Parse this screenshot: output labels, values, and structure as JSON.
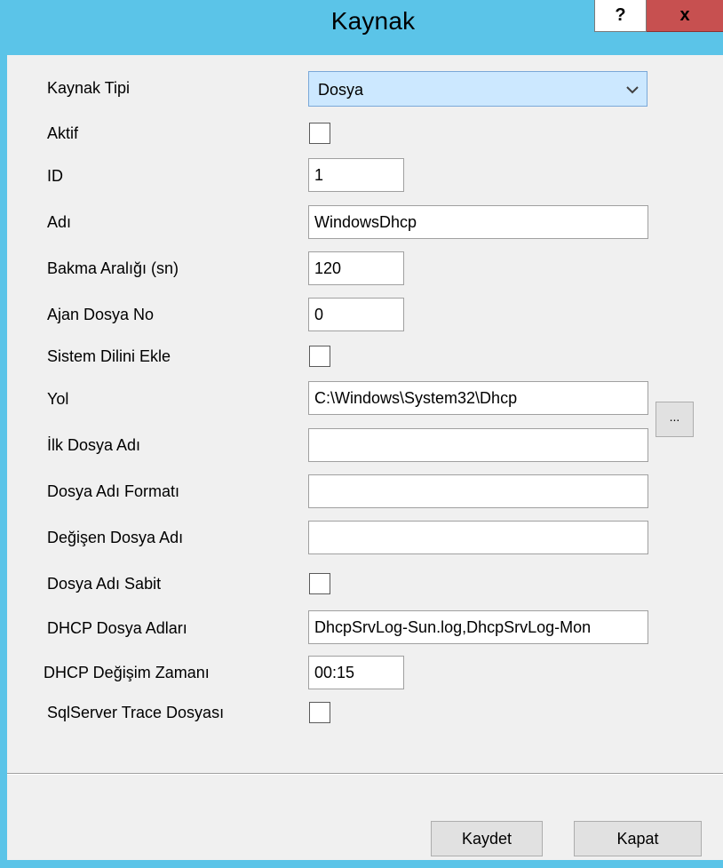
{
  "window": {
    "title": "Kaynak",
    "help_label": "?",
    "close_label": "x"
  },
  "form": {
    "rows": [
      {
        "label": "Kaynak Tipi",
        "type": "combo",
        "value": "Dosya"
      },
      {
        "label": "Aktif",
        "type": "checkbox",
        "checked": false
      },
      {
        "label": "ID",
        "type": "input",
        "value": "1"
      },
      {
        "label": "Adı",
        "type": "input",
        "value": "WindowsDhcp"
      },
      {
        "label": "Bakma Aralığı (sn)",
        "type": "input",
        "value": "120"
      },
      {
        "label": "Ajan Dosya No",
        "type": "input",
        "value": "0"
      },
      {
        "label": "Sistem Dilini Ekle",
        "type": "checkbox",
        "checked": false
      },
      {
        "label": "Yol",
        "type": "input",
        "value": "C:\\Windows\\System32\\Dhcp"
      },
      {
        "label": "İlk Dosya Adı",
        "type": "input",
        "value": ""
      },
      {
        "label": "Dosya Adı Formatı",
        "type": "input",
        "value": ""
      },
      {
        "label": "Değişen Dosya Adı",
        "type": "input",
        "value": ""
      },
      {
        "label": "Dosya Adı Sabit",
        "type": "checkbox",
        "checked": false
      },
      {
        "label": "DHCP Dosya Adları",
        "type": "input",
        "value": "DhcpSrvLog-Sun.log,DhcpSrvLog-Mon"
      },
      {
        "label": "DHCP Değişim Zamanı",
        "type": "input",
        "value": "00:15"
      },
      {
        "label": "SqlServer Trace Dosyası",
        "type": "checkbox",
        "checked": false
      }
    ],
    "browse_label": "..."
  },
  "buttons": {
    "save_label": "Kaydet",
    "close_label": "Kapat"
  },
  "colors": {
    "titlebar": "#5bc4e8",
    "close_button": "#c75050",
    "combo_bg": "#cce8ff",
    "dialog_bg": "#f0f0f0"
  }
}
